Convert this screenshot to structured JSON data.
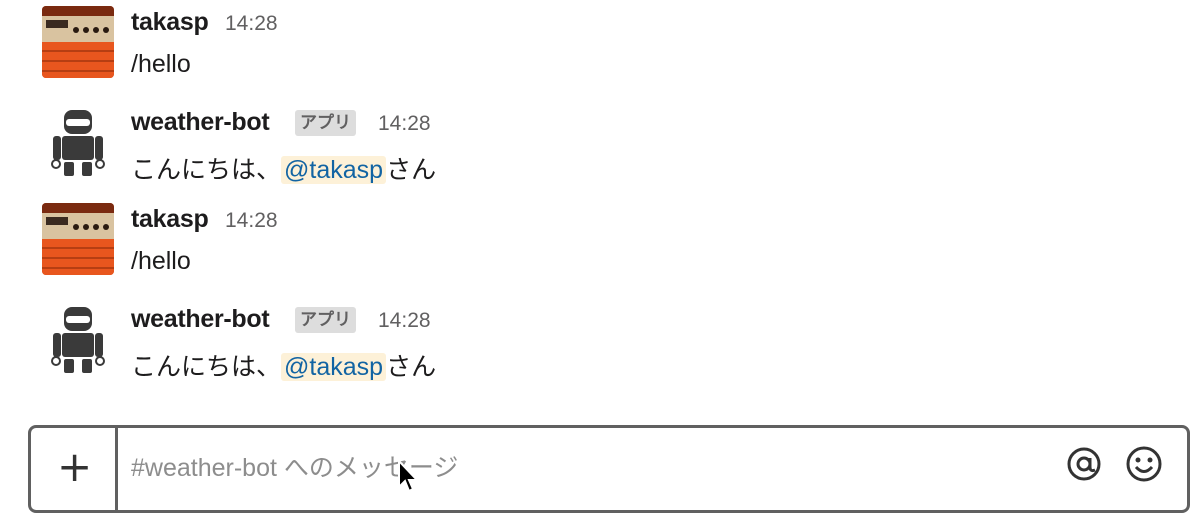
{
  "messages": [
    {
      "author": "takasp",
      "time": "14:28",
      "text": "/hello",
      "is_bot": false
    },
    {
      "author": "weather-bot",
      "badge": "アプリ",
      "time": "14:28",
      "text_before": "こんにちは、",
      "mention": "@takasp",
      "text_after": "さん",
      "is_bot": true
    },
    {
      "author": "takasp",
      "time": "14:28",
      "text": "/hello",
      "is_bot": false
    },
    {
      "author": "weather-bot",
      "badge": "アプリ",
      "time": "14:28",
      "text_before": "こんにちは、",
      "mention": "@takasp",
      "text_after": "さん",
      "is_bot": true
    }
  ],
  "composer": {
    "plus_icon": "plus-icon",
    "placeholder": "#weather-bot へのメッセージ",
    "at_icon": "at-icon",
    "emoji_icon": "emoji-icon"
  },
  "colors": {
    "mention_bg": "#fdf1d8",
    "mention_text": "#1264a3",
    "badge_bg": "#dddddd",
    "border": "#606060"
  }
}
